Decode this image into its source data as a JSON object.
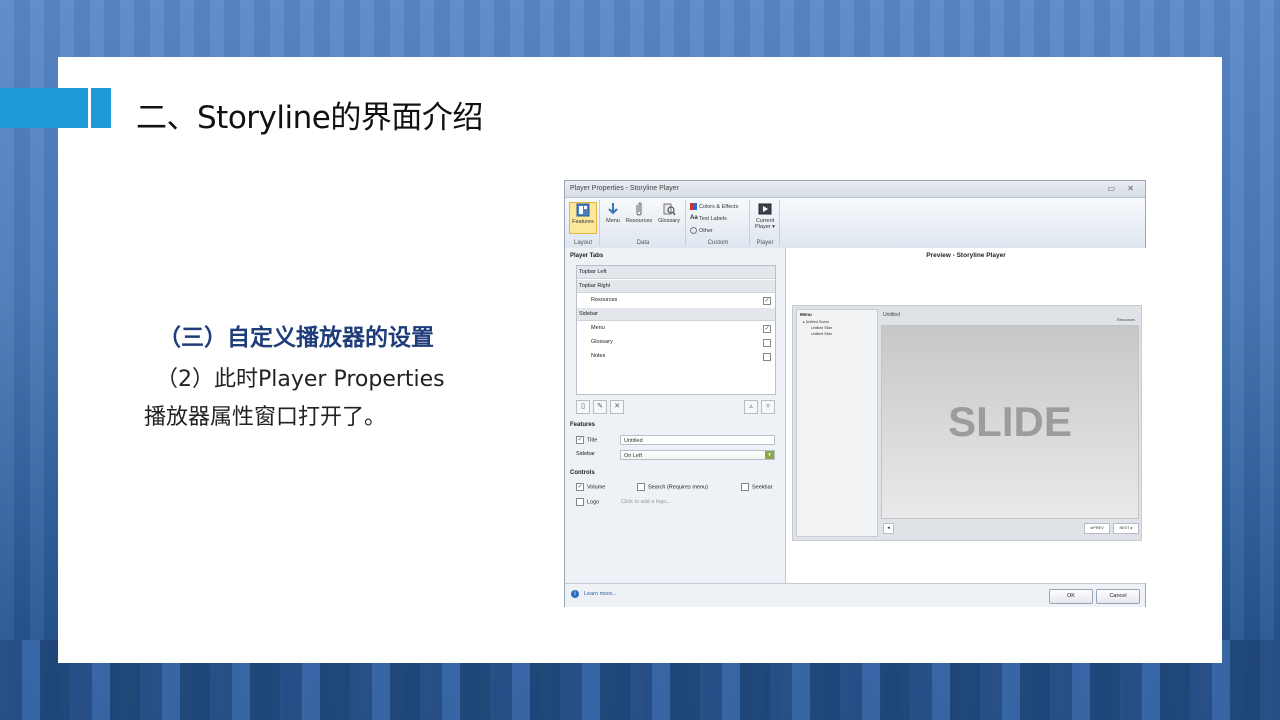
{
  "slide": {
    "title": "二、Storyline的界面介绍",
    "subheading": "（三）自定义播放器的设置",
    "para_line1": "（2）此时Player  Properties",
    "para_line2": "播放器属性窗口打开了。"
  },
  "window": {
    "title": "Player Properties - Storyline Player",
    "controls": "▭ ✕",
    "ribbon": {
      "layout": {
        "features": "Features",
        "group": "Layout"
      },
      "data": {
        "menu": "Menu",
        "resources": "Resources",
        "glossary": "Glossary",
        "group": "Data"
      },
      "custom": {
        "colors": "Colors & Effects",
        "text_labels": "Text Labels",
        "other": "Other",
        "group": "Custom"
      },
      "player": {
        "current_line1": "Current",
        "current_line2": "Player ▾",
        "group": "Player"
      }
    },
    "player_tabs": {
      "header": "Player Tabs",
      "topbar_left": "Topbar Left",
      "topbar_right": "Topbar Right",
      "resources": "Resources",
      "sidebar": "Sidebar",
      "menu": "Menu",
      "glossary": "Glossary",
      "notes": "Notes",
      "checks": {
        "resources": true,
        "menu": true,
        "glossary": false,
        "notes": false
      }
    },
    "features": {
      "header": "Features",
      "title_label": "Title",
      "title_value": "Untitled",
      "sidebar_label": "Sidebar",
      "sidebar_value": "On Left"
    },
    "controls_section": {
      "header": "Controls",
      "volume": "Volume",
      "search": "Search (Requires menu)",
      "seekbar": "Seekbar",
      "logo": "Logo",
      "logo_placeholder": "Click to add a logo..."
    },
    "preview": {
      "header": "Preview - Storyline Player",
      "menu_header": "Menu",
      "scene": "▸ Untitled Scene",
      "slide1": "Untitled Slide",
      "slide2": "Untitled Slide",
      "title": "Untitled",
      "resources": "Resources",
      "slide_text": "SLIDE",
      "prev": "◂ PREV",
      "next": "NEXT ▸"
    },
    "footer": {
      "learn_more": "Learn more...",
      "ok": "OK",
      "cancel": "Cancel"
    }
  }
}
